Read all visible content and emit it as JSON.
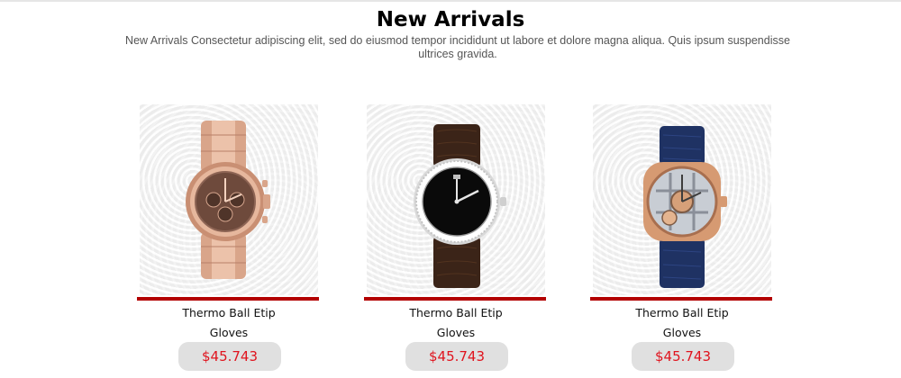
{
  "section": {
    "title": "New Arrivals",
    "description": "New Arrivals Consectetur adipiscing elit, sed do eiusmod tempor incididunt ut labore et dolore magna aliqua. Quis ipsum suspendisse ultrices gravida."
  },
  "products": [
    {
      "name_line1": "Thermo Ball Etip",
      "name_line2": "Gloves",
      "price": "$45.743",
      "image": "rose-gold-chronograph-watch"
    },
    {
      "name_line1": "Thermo Ball Etip",
      "name_line2": "Gloves",
      "price": "$45.743",
      "image": "black-dial-diamond-bezel-watch"
    },
    {
      "name_line1": "Thermo Ball Etip",
      "name_line2": "Gloves",
      "price": "$45.743",
      "image": "skeleton-tourbillon-watch"
    }
  ],
  "colors": {
    "accent_bar": "#b30000",
    "price_text": "#e0141e",
    "price_pill": "#e0e0e0"
  }
}
